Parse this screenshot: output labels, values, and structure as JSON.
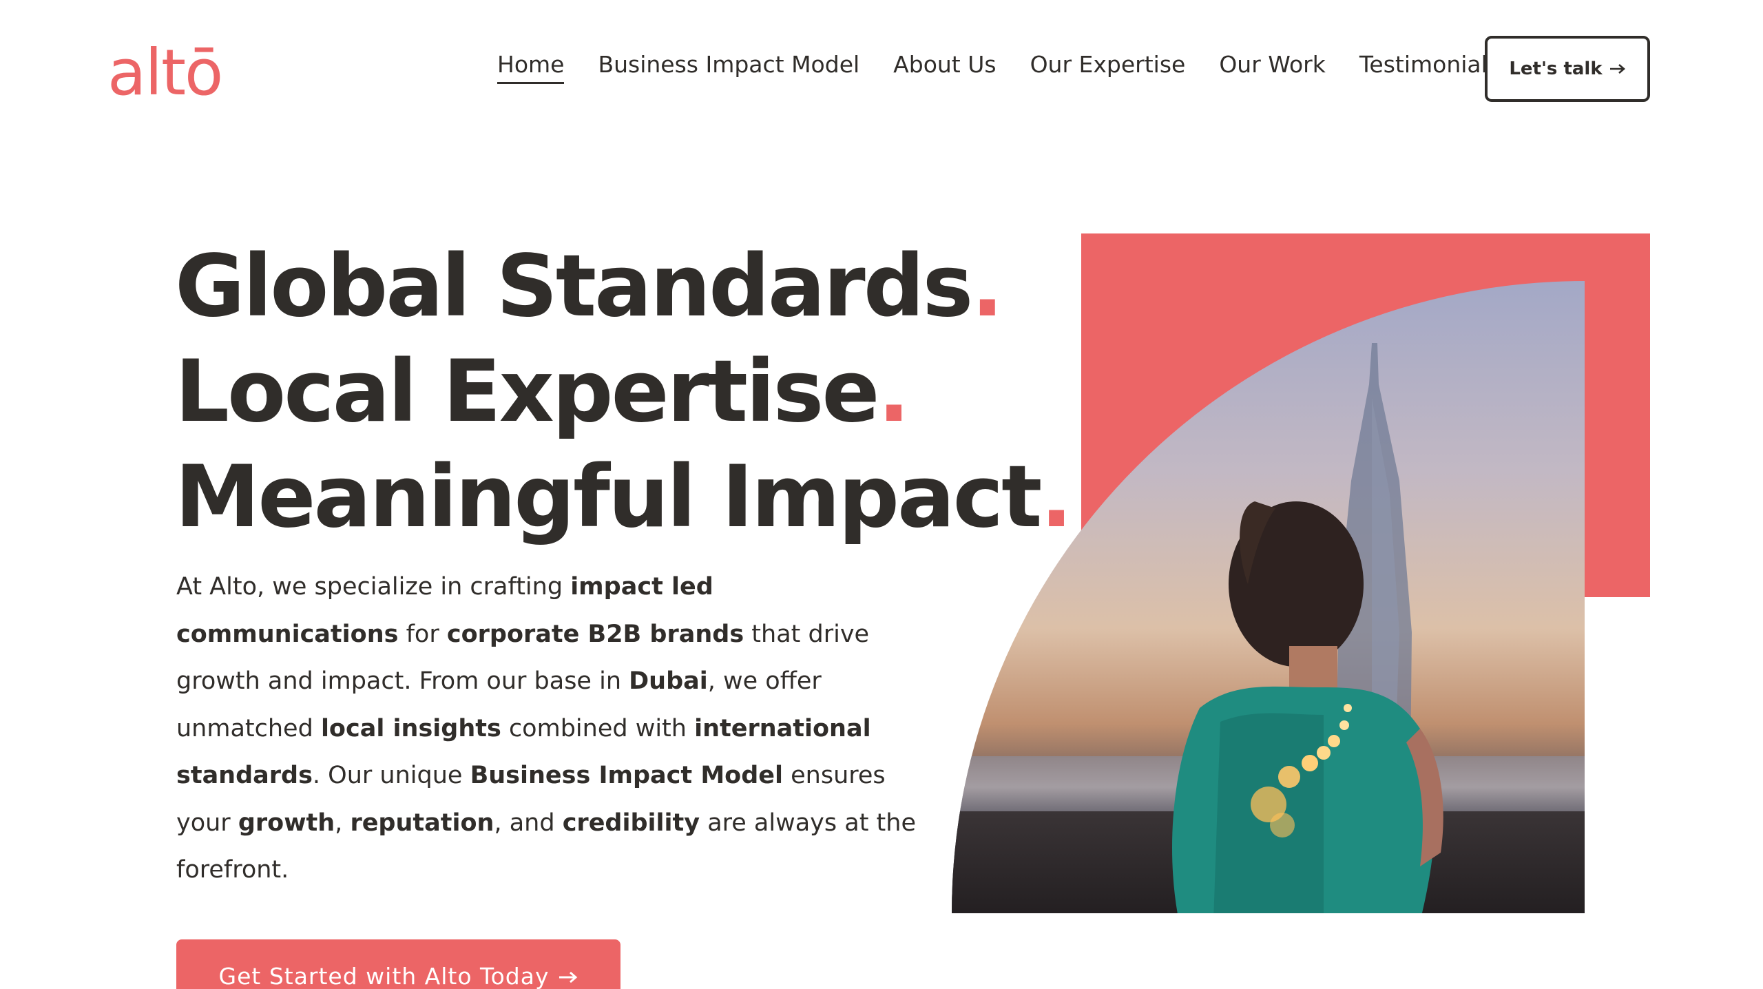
{
  "brand": {
    "logo_text": "altō",
    "accent_color": "#ec6566",
    "text_color": "#302d2a"
  },
  "nav": {
    "items": [
      {
        "label": "Home",
        "active": true
      },
      {
        "label": "Business Impact Model"
      },
      {
        "label": "About Us"
      },
      {
        "label": "Our Expertise"
      },
      {
        "label": "Our Work"
      },
      {
        "label": "Testimonials"
      }
    ],
    "cta_label": "Let's talk",
    "cta_icon": "arrow-right-icon"
  },
  "hero": {
    "lines": [
      {
        "text": "Global Standards",
        "dot": "."
      },
      {
        "text": "Local Expertise",
        "dot": "."
      },
      {
        "text": "Meaningful Impact",
        "dot": "."
      }
    ],
    "description": {
      "p1": "At Alto, we specialize in crafting ",
      "b1": "impact led communications",
      "p2": " for ",
      "b2": "corporate B2B brands",
      "p3": " that drive growth and impact. From our base in ",
      "b3": "Dubai",
      "p4": ", we offer unmatched ",
      "b4": "local insights",
      "p5": " combined with ",
      "b5": "international standards",
      "p6": ".  Our unique ",
      "b6": "Business Impact Model",
      "p7": " ensures your ",
      "b7": "growth",
      "p8": ", ",
      "b8": "reputation",
      "p9": ", and ",
      "b9": "credibility",
      "p10": " are always at the forefront."
    },
    "cta_label": "Get Started with Alto Today",
    "cta_icon": "arrow-right-icon"
  }
}
